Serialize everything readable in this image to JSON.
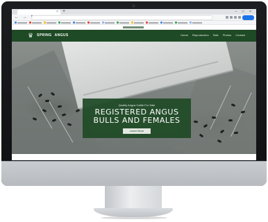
{
  "browser": {
    "tab_close": "×",
    "new_tab": "+",
    "window_controls": "– □ ×",
    "nav_buttons": "← → ↻",
    "url": "",
    "bookmarks_count_hint": "",
    "bookmark_colors": [
      "#4285f4",
      "#e94235",
      "#fbbc04",
      "#34a853",
      "#4285f4",
      "#e94235",
      "#8ab4f8",
      "#34a853",
      "#fbbc04",
      "#e94235",
      "#4285f4",
      "#34a853",
      "#8ab4f8"
    ]
  },
  "site": {
    "logo_glyph": "♛",
    "brand": [
      "SPRING",
      "ANGUS"
    ],
    "nav_links": [
      "Home",
      "Reproduction",
      "Sale",
      "Photos",
      "Contact"
    ],
    "hero": {
      "eyebrow": "Quality Angus Cattle For Sale",
      "title_line1": "REGISTERED ANGUS",
      "title_line2": "BULLS AND FEMALES",
      "cta_label": "Learn More"
    }
  },
  "colors": {
    "brand_green": "#1e4a25",
    "bezel": "#0f1012",
    "chin": "#c1c4c8"
  }
}
